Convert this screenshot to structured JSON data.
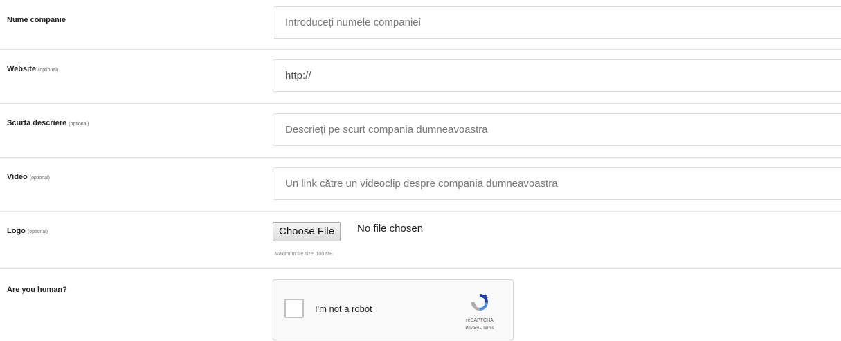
{
  "form": {
    "company_name": {
      "label": "Nume companie",
      "placeholder": "Introduceți numele companiei"
    },
    "website": {
      "label": "Website",
      "optional": "(optional)",
      "value": "http://"
    },
    "description": {
      "label": "Scurta descriere",
      "optional": "(optional)",
      "placeholder": "Descrieți pe scurt compania dumneavoastra"
    },
    "video": {
      "label": "Video",
      "optional": "(optional)",
      "placeholder": "Un link către un videoclip despre compania dumneavoastra"
    },
    "logo": {
      "label": "Logo",
      "optional": "(optional)",
      "button_label": "Choose File",
      "status": "No file chosen",
      "hint": "Maximum file size: 100 MB."
    },
    "captcha": {
      "label": "Are you human?",
      "checkbox_label": "I'm not a robot",
      "brand": "reCAPTCHA",
      "links": "Privacy - Terms"
    }
  },
  "colors": {
    "border": "#dcdcdc",
    "divider": "#e3e3e3",
    "captcha_blue": "#4a90e2"
  }
}
